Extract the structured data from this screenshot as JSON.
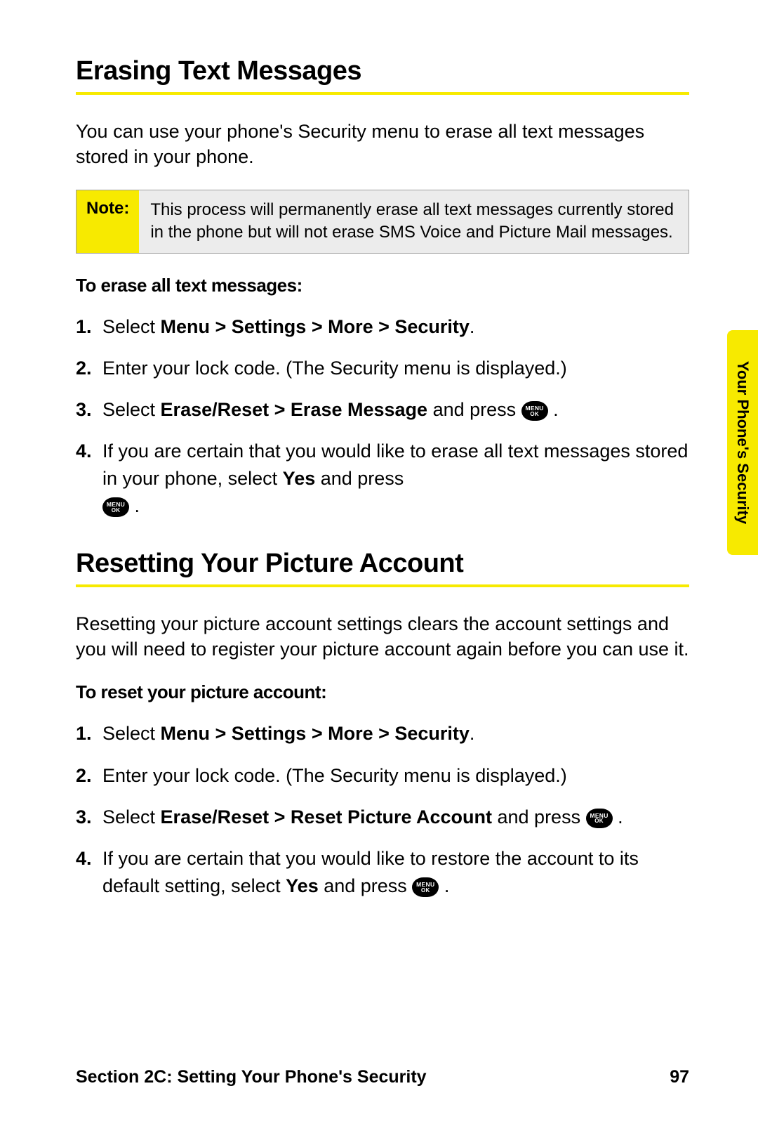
{
  "section1": {
    "title": "Erasing Text Messages",
    "intro": "You can use your phone's Security menu to erase all text messages stored in your phone.",
    "note_label": "Note:",
    "note_body": "This process will permanently erase all text messages currently stored in the phone but will not erase SMS Voice and Picture Mail messages.",
    "subhead": "To erase all text messages:",
    "steps": {
      "s1_a": "Select ",
      "s1_b": "Menu > Settings > More > Security",
      "s1_c": ".",
      "s2": "Enter your lock code. (The Security menu is displayed.)",
      "s3_a": "Select ",
      "s3_b": "Erase/Reset > Erase Message",
      "s3_c": " and press ",
      "s3_d": ".",
      "s4_a": "If you are certain that you would like to erase all text messages stored in your phone, select ",
      "s4_b": "Yes",
      "s4_c": " and press ",
      "s4_d": "."
    }
  },
  "section2": {
    "title": "Resetting Your Picture Account",
    "intro": "Resetting your picture account settings clears the account settings and you will need to register your picture account again before you can use it.",
    "subhead": "To reset your picture account:",
    "steps": {
      "s1_a": "Select ",
      "s1_b": "Menu > Settings > More > Security",
      "s1_c": ".",
      "s2": "Enter your lock code. (The Security menu is displayed.)",
      "s3_a": "Select ",
      "s3_b": "Erase/Reset > Reset Picture Account",
      "s3_c": " and press ",
      "s3_d": ".",
      "s4_a": "If you are certain that you would like to restore the account to its default setting, select ",
      "s4_b": "Yes",
      "s4_c": " and press ",
      "s4_d": "."
    }
  },
  "icon": {
    "line1": "MENU",
    "line2": "OK"
  },
  "sidetab": "Your Phone's Security",
  "footer": {
    "left": "Section 2C: Setting Your Phone's Security",
    "right": "97"
  }
}
